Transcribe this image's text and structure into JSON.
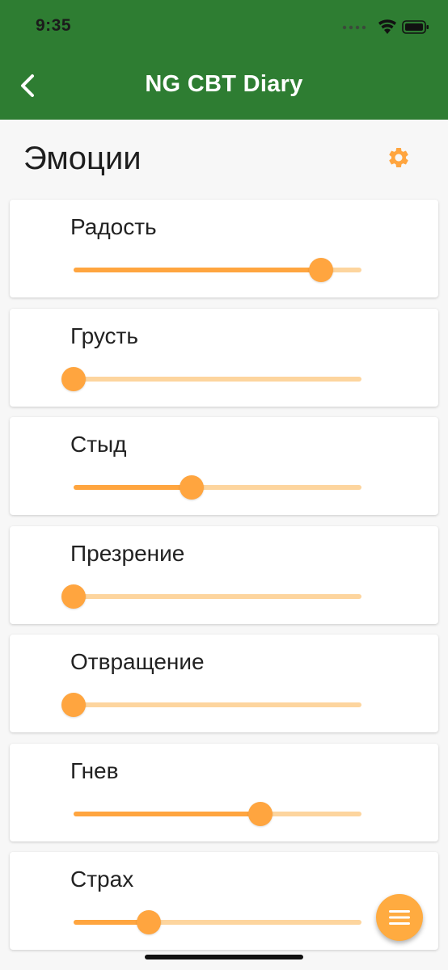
{
  "status_bar": {
    "time": "9:35"
  },
  "header": {
    "title": "NG CBT Diary",
    "back_icon": "chevron-left-icon"
  },
  "page": {
    "title": "Эмоции",
    "settings_icon": "gear-icon"
  },
  "emotions": [
    {
      "label": "Радость",
      "value": 0.86
    },
    {
      "label": "Грусть",
      "value": 0.0
    },
    {
      "label": "Стыд",
      "value": 0.41
    },
    {
      "label": "Презрение",
      "value": 0.0
    },
    {
      "label": "Отвращение",
      "value": 0.0
    },
    {
      "label": "Гнев",
      "value": 0.65
    },
    {
      "label": "Страх",
      "value": 0.26
    }
  ],
  "fab": {
    "icon": "menu-icon"
  },
  "colors": {
    "app_bar": "#2e7d32",
    "accent": "#ffa53f",
    "slider_track": "#fdd59e",
    "background": "#f7f7f7"
  }
}
